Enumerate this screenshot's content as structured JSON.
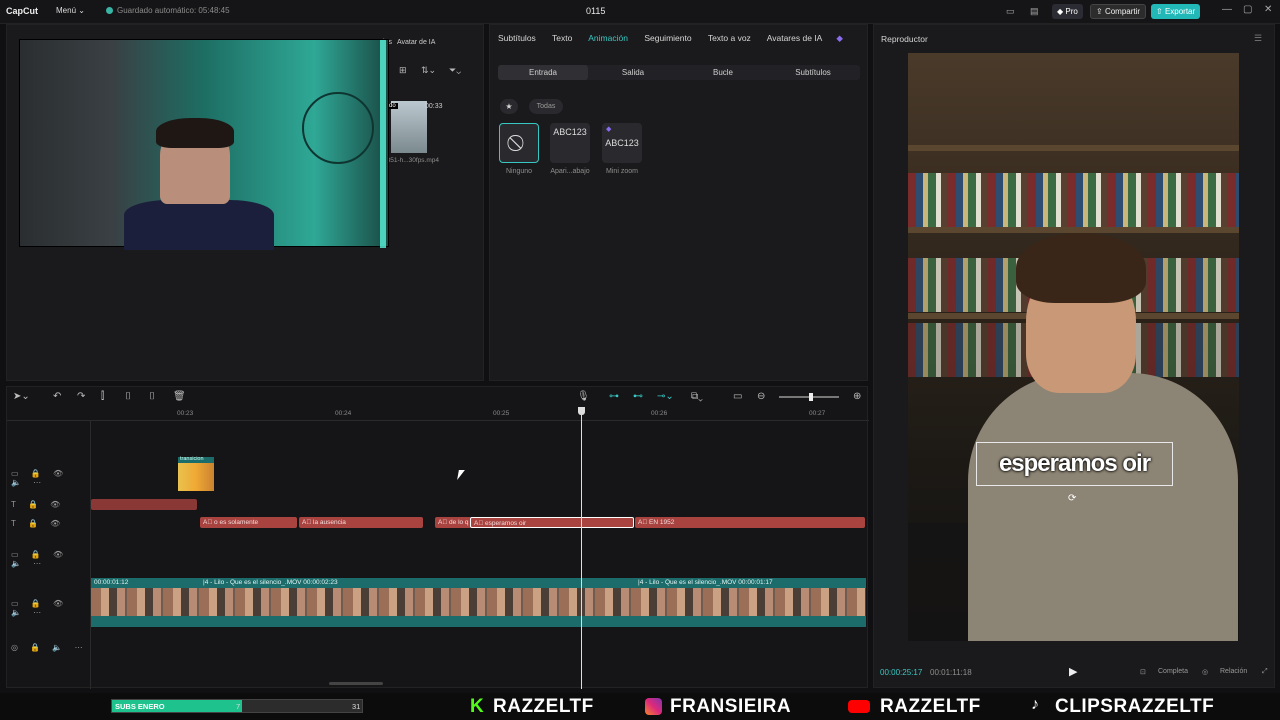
{
  "app": {
    "logo": "CapCut",
    "menu": "Menú ⌄",
    "autosave": "Guardado automático: 05:48:45",
    "project_title": "0115"
  },
  "topbar": {
    "pro": "Pro",
    "share": "Compartir",
    "export": "Exportar",
    "minimize": "—",
    "maximize": "▢",
    "close": "✕"
  },
  "media": {
    "tab_avatar": "Avatar de IA",
    "tab_partial": "las",
    "clip_duration": "00:33",
    "clip_name": "8851-h...30fps.mp4",
    "clip_tag": "adido"
  },
  "animation_panel": {
    "tabs": [
      "Subtítulos",
      "Texto",
      "Animación",
      "Seguimiento",
      "Texto a voz",
      "Avatares de IA"
    ],
    "active_tab": "Animación",
    "subtabs": [
      "Entrada",
      "Salida",
      "Bucle",
      "Subtítulos"
    ],
    "active_subtab": "Entrada",
    "filter_all": "Todas",
    "presets": [
      {
        "label": "Ninguno",
        "preview": "⃠"
      },
      {
        "label": "Apari...abajo",
        "preview": "ABC123"
      },
      {
        "label": "Mini zoom",
        "preview": "ABC123"
      }
    ]
  },
  "player": {
    "title": "Reproductor",
    "caption": "esperamos oir",
    "current_time": "00:00:25:17",
    "total_time": "00:01:11:18",
    "full": "Completa",
    "ratio": "Relación"
  },
  "timeline": {
    "ruler": [
      "00:23",
      "00:24",
      "00:25",
      "00:26",
      "00:27"
    ],
    "text_segments": [
      "o es solamente",
      "la ausencia",
      "de lo q",
      "esperamos oir",
      "EN 1952"
    ],
    "effect_label": "transicion",
    "video_labels": [
      "00:00:01:12",
      "|4 - Lilo - Que es el silencio_.MOV   00:00:02:23",
      "|4 - Lilo - Que es el silencio_.MOV   00:00:01:17"
    ]
  },
  "stream": {
    "subs_label": "SUBS ENERO",
    "subs_current": "7",
    "subs_goal": "31",
    "subs_progress": 0.52,
    "socials": [
      "RAZZELTF",
      "FRANSIEIRA",
      "RAZZELTF",
      "CLIPSRAZZELTF"
    ],
    "colors": {
      "kick": "#53fc18",
      "instagram": "#e1306c",
      "youtube": "#ff0000",
      "tiktok": "#ffffff"
    }
  }
}
